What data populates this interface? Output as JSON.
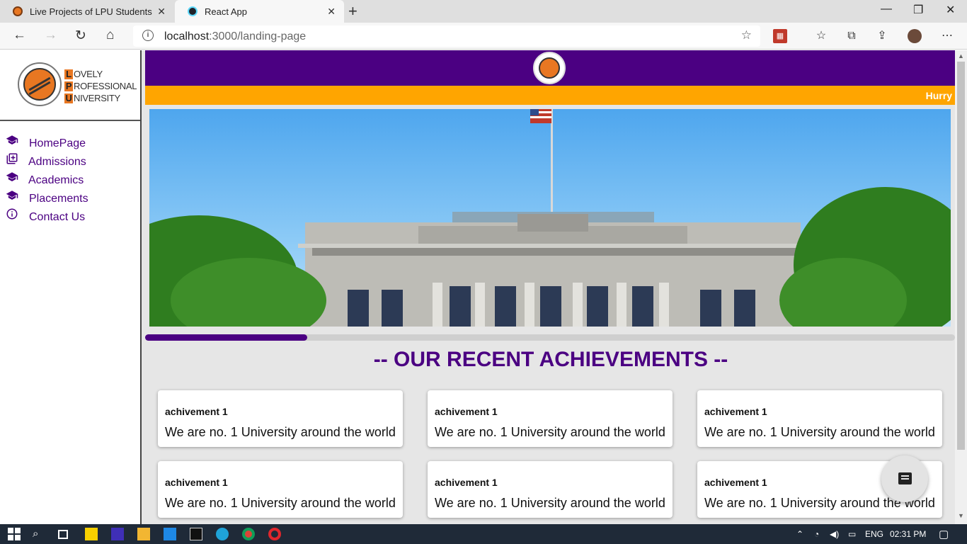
{
  "browser": {
    "tabs": [
      {
        "title": "Live Projects of LPU Students",
        "active": false
      },
      {
        "title": "React App",
        "active": true
      }
    ],
    "address": {
      "host": "localhost",
      "rest": ":3000/landing-page"
    },
    "info_glyph": "i"
  },
  "sidebar": {
    "logo": {
      "line1_cap": "L",
      "line1_rest": "OVELY",
      "line2_cap": "P",
      "line2_rest": "ROFESSIONAL",
      "line3_cap": "U",
      "line3_rest": "NIVERSITY"
    },
    "items": [
      {
        "label": "HomePage",
        "icon": "graduation-cap-icon"
      },
      {
        "label": "Admissions",
        "icon": "add-box-icon"
      },
      {
        "label": "Academics",
        "icon": "graduation-cap-icon"
      },
      {
        "label": "Placements",
        "icon": "graduation-cap-icon"
      },
      {
        "label": "Contact Us",
        "icon": "info-icon"
      }
    ]
  },
  "banner": {
    "marquee_text": "Hurry"
  },
  "carousel": {
    "progress_fraction": 0.2
  },
  "achievements": {
    "title": "-- OUR RECENT ACHIEVEMENTS --",
    "cards": [
      {
        "title": "achivement 1",
        "body": "We are no. 1 University around the world"
      },
      {
        "title": "achivement 1",
        "body": "We are no. 1 University around the world"
      },
      {
        "title": "achivement 1",
        "body": "We are no. 1 University around the world"
      },
      {
        "title": "achivement 1",
        "body": "We are no. 1 University around the world"
      },
      {
        "title": "achivement 1",
        "body": "We are no. 1 University around the world"
      },
      {
        "title": "achivement 1",
        "body": "We are no. 1 University around the world"
      }
    ]
  },
  "taskbar": {
    "language": "ENG",
    "time": "02:31 PM"
  },
  "colors": {
    "brand_purple": "#4b0082",
    "brand_orange": "#ffa500",
    "logo_orange": "#e87722"
  }
}
